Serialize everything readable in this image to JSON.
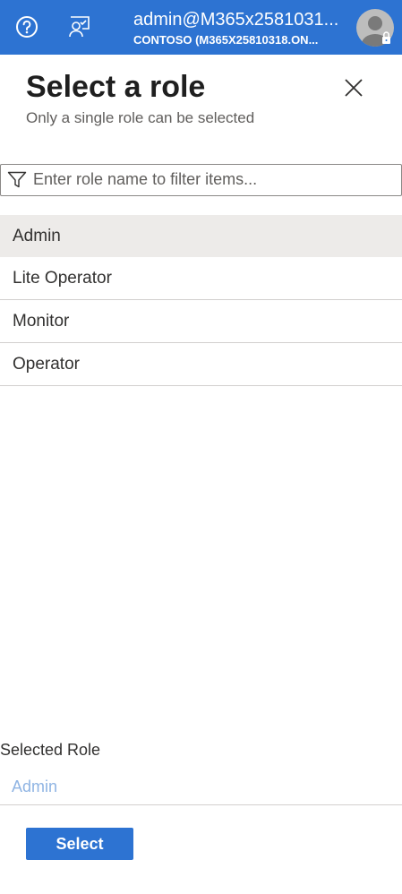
{
  "topbar": {
    "help_icon": "help-circle-icon",
    "feedback_icon": "feedback-person-icon",
    "account_name": "admin@M365x2581031...",
    "tenant": "CONTOSO (M365X25810318.ON...",
    "avatar_icon": "user-avatar-lock-icon",
    "bg_color": "#2d73d2"
  },
  "panel": {
    "title": "Select a role",
    "subtitle": "Only a single role can be selected",
    "close_icon": "close-icon"
  },
  "filter": {
    "placeholder": "Enter role name to filter items...",
    "value": "",
    "icon": "filter-funnel-icon"
  },
  "roles": [
    {
      "label": "Admin",
      "selected": true
    },
    {
      "label": "Lite Operator",
      "selected": false
    },
    {
      "label": "Monitor",
      "selected": false
    },
    {
      "label": "Operator",
      "selected": false
    }
  ],
  "footer": {
    "selected_label": "Selected Role",
    "selected_value": "Admin",
    "select_button": "Select"
  }
}
